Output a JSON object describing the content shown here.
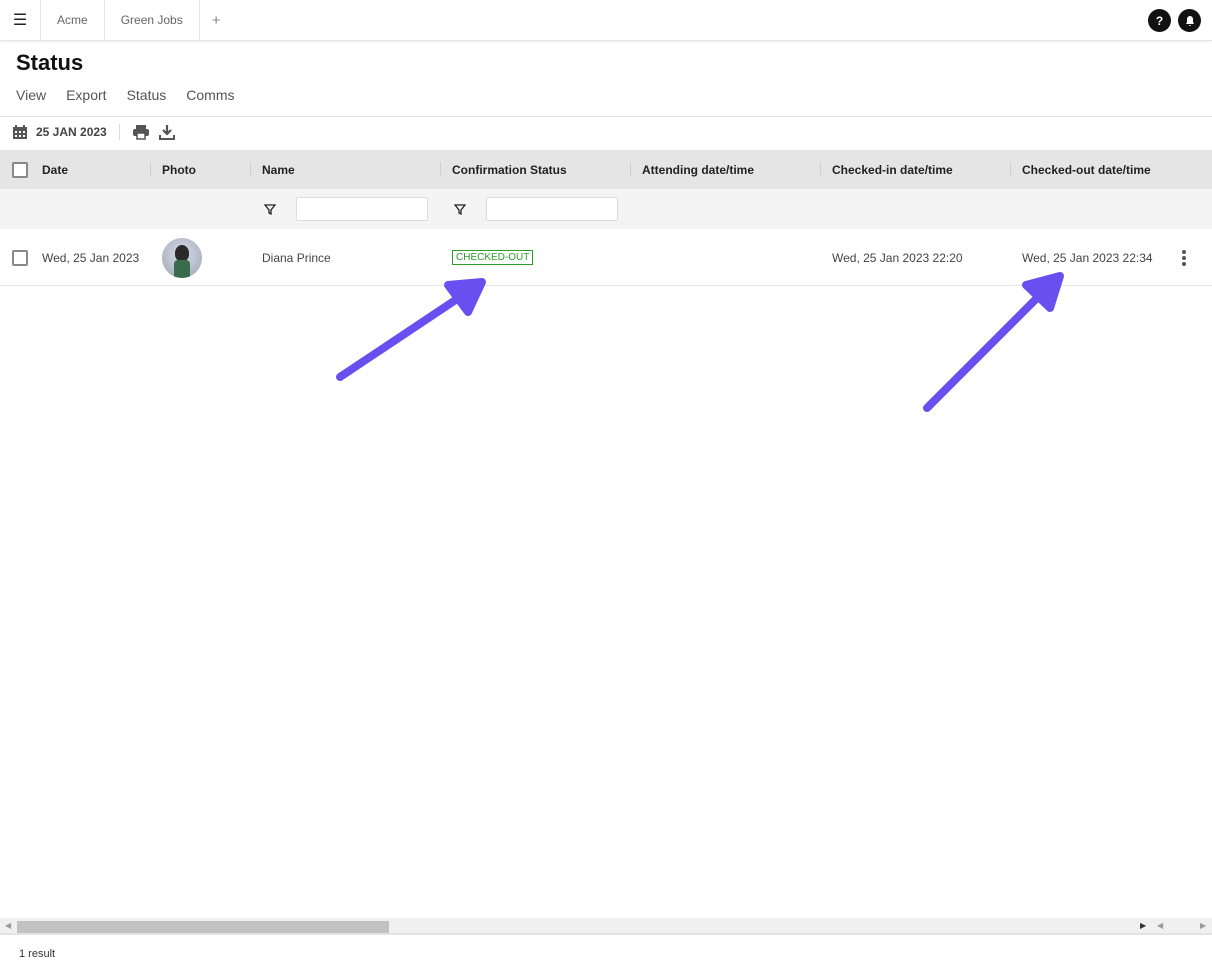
{
  "topbar": {
    "tabs": [
      "Acme",
      "Green Jobs"
    ],
    "add": "+",
    "help": "?",
    "bell": "🔔"
  },
  "page": {
    "title": "Status",
    "subnav": [
      "View",
      "Export",
      "Status",
      "Comms"
    ]
  },
  "toolbar": {
    "date": "25 JAN 2023"
  },
  "table": {
    "headers": [
      "Date",
      "Photo",
      "Name",
      "Confirmation Status",
      "Attending date/time",
      "Checked-in date/time",
      "Checked-out date/time"
    ],
    "rows": [
      {
        "date": "Wed, 25 Jan 2023",
        "name": "Diana Prince",
        "status": "CHECKED-OUT",
        "attending": "",
        "checked_in": "Wed, 25 Jan 2023 22:20",
        "checked_out": "Wed, 25 Jan 2023 22:34"
      }
    ]
  },
  "footer": {
    "results": "1 result"
  },
  "colors": {
    "badge": "#2a9d2a",
    "arrow": "#6a4ff0"
  }
}
